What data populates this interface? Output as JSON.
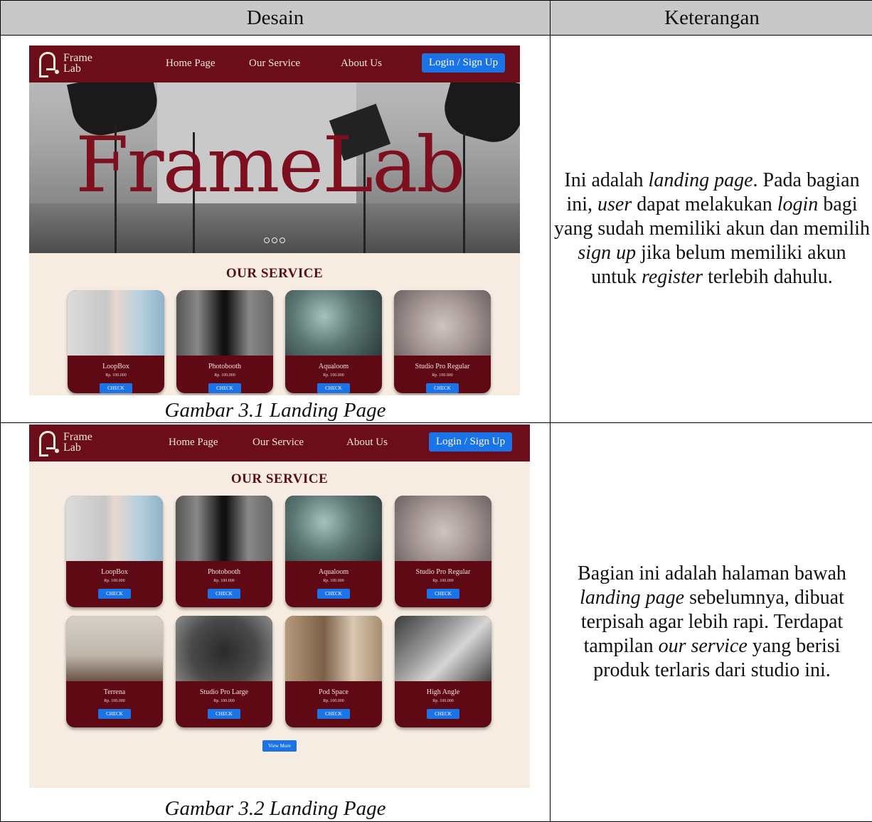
{
  "table": {
    "headers": [
      "Desain",
      "Keterangan"
    ]
  },
  "mockup": {
    "logo_line1": "Frame",
    "logo_line2": "Lab",
    "nav": [
      "Home Page",
      "Our Service",
      "About Us"
    ],
    "login_button": "Login / Sign Up",
    "hero_title": "FrameLab",
    "service_heading": "OUR SERVICE",
    "view_more": "View More",
    "services": [
      {
        "name": "LoopBox",
        "price": "Rp. 100.000",
        "button": "CHECK"
      },
      {
        "name": "Photobooth",
        "price": "Rp. 100.000",
        "button": "CHECK"
      },
      {
        "name": "Aqualoom",
        "price": "Rp. 100.000",
        "button": "CHECK"
      },
      {
        "name": "Studio Pro Regular",
        "price": "Rp. 100.000",
        "button": "CHECK"
      },
      {
        "name": "Terrena",
        "price": "Rp. 100.000",
        "button": "CHECK"
      },
      {
        "name": "Studio Pro Large",
        "price": "Rp. 100.000",
        "button": "CHECK"
      },
      {
        "name": "Pod Space",
        "price": "Rp. 100.000",
        "button": "CHECK"
      },
      {
        "name": "High Angle",
        "price": "Rp. 100.000",
        "button": "CHECK"
      }
    ]
  },
  "rows": [
    {
      "caption": "Gambar 3.1 Landing Page",
      "desc": {
        "a": "Ini adalah ",
        "b": "landing page",
        "c": ". Pada bagian ini, ",
        "d": "user",
        "e": " dapat melakukan ",
        "f": "login",
        "g": " bagi yang sudah memiliki akun dan memilih ",
        "h": "sign up",
        "i": " jika belum memiliki akun untuk ",
        "j": "register",
        "k": " terlebih dahulu."
      }
    },
    {
      "caption": "Gambar 3.2 Landing Page",
      "desc": {
        "a": "Bagian ini adalah halaman bawah ",
        "b": "landing page",
        "c": " sebelumnya, dibuat terpisah agar lebih rapi. Terdapat tampilan ",
        "d": "our service",
        "e": " yang berisi produk terlaris dari studio ini."
      }
    }
  ]
}
